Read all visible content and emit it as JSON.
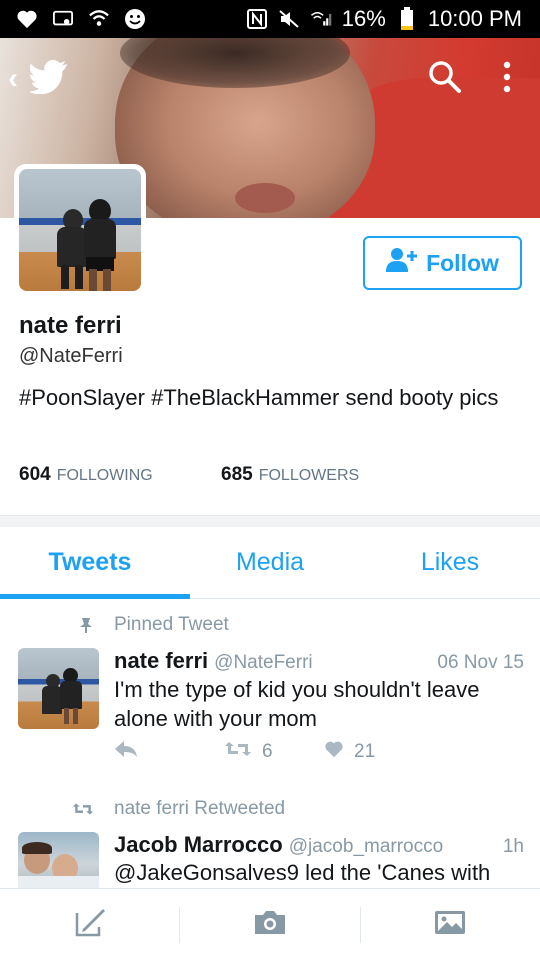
{
  "status_bar": {
    "battery": "16%",
    "time": "10:00 PM"
  },
  "profile": {
    "name": "nate ferri",
    "handle": "@NateFerri",
    "bio": "#PoonSlayer #TheBlackHammer send booty pics",
    "following_count": "604",
    "following_label": "FOLLOWING",
    "followers_count": "685",
    "followers_label": "FOLLOWERS",
    "follow_label": "Follow"
  },
  "tabs": [
    {
      "label": "Tweets",
      "active": true
    },
    {
      "label": "Media",
      "active": false
    },
    {
      "label": "Likes",
      "active": false
    }
  ],
  "tweets": [
    {
      "context": "Pinned Tweet",
      "name": "nate ferri",
      "handle": "@NateFerri",
      "time": "06 Nov 15",
      "text": "I'm the type of kid you shouldn't leave alone with your mom",
      "retweets": "6",
      "likes": "21"
    },
    {
      "context": "nate ferri Retweeted",
      "name": "Jacob Marrocco",
      "handle": "@jacob_marrocco",
      "time": "1h",
      "text": "@JakeGonsalves9 led the 'Canes with"
    }
  ],
  "colors": {
    "accent": "#1da1f2",
    "muted": "#8899a6",
    "text": "#14171a"
  },
  "icons": [
    "heart-icon",
    "cast-icon",
    "wifi-icon",
    "smiley-icon",
    "nfc-icon",
    "mute-icon",
    "signal-icon",
    "battery-icon",
    "back-icon",
    "twitter-bird-icon",
    "search-icon",
    "more-icon",
    "add-user-icon",
    "pin-icon",
    "reply-icon",
    "retweet-icon",
    "like-icon",
    "compose-icon",
    "camera-icon",
    "gallery-icon"
  ]
}
